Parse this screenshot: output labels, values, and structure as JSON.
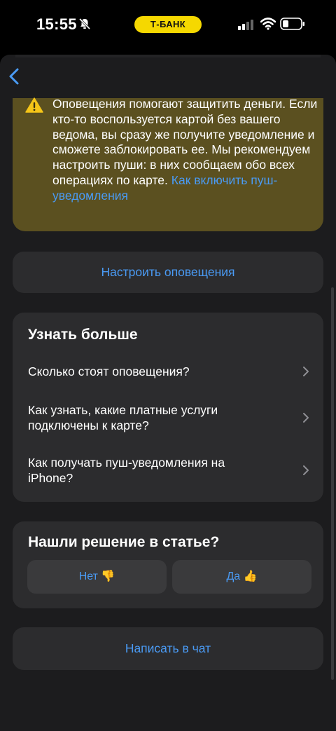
{
  "status_bar": {
    "time": "15:55",
    "bank_pill": "Т-БАНК",
    "icons": [
      "bell-slash-icon",
      "signal-icon",
      "wifi-icon",
      "battery-icon"
    ]
  },
  "nav": {
    "back_icon": "chevron-left-icon"
  },
  "warning": {
    "icon": "warning-triangle-icon",
    "text": "Оповещения помогают защитить деньги. Если кто-то воспользуется картой без вашего ведома, вы сразу же получите уведомление и сможете заблокировать ее. Мы рекомендуем настроить пуши: в них сообщаем обо всех операциях по карте.",
    "link": "Как включить пуш-уведомления"
  },
  "setup_button": "Настроить оповещения",
  "learn_more": {
    "title": "Узнать больше",
    "items": [
      {
        "label": "Сколько стоят оповещения?"
      },
      {
        "label": "Как узнать, какие платные услуги подключены к карте?"
      },
      {
        "label": "Как получать пуш-уведомления на iPhone?"
      }
    ]
  },
  "feedback": {
    "title": "Нашли решение в статье?",
    "no": "Нет 👎",
    "yes": "Да 👍"
  },
  "chat_button": "Написать в чат",
  "colors": {
    "accent": "#4a9bf5",
    "warning_bg": "#5b5020",
    "warning_icon": "#f5c518",
    "card_bg": "#2c2c2e",
    "sheet_bg": "#1c1c1e",
    "pill_bg": "#f5d800"
  }
}
